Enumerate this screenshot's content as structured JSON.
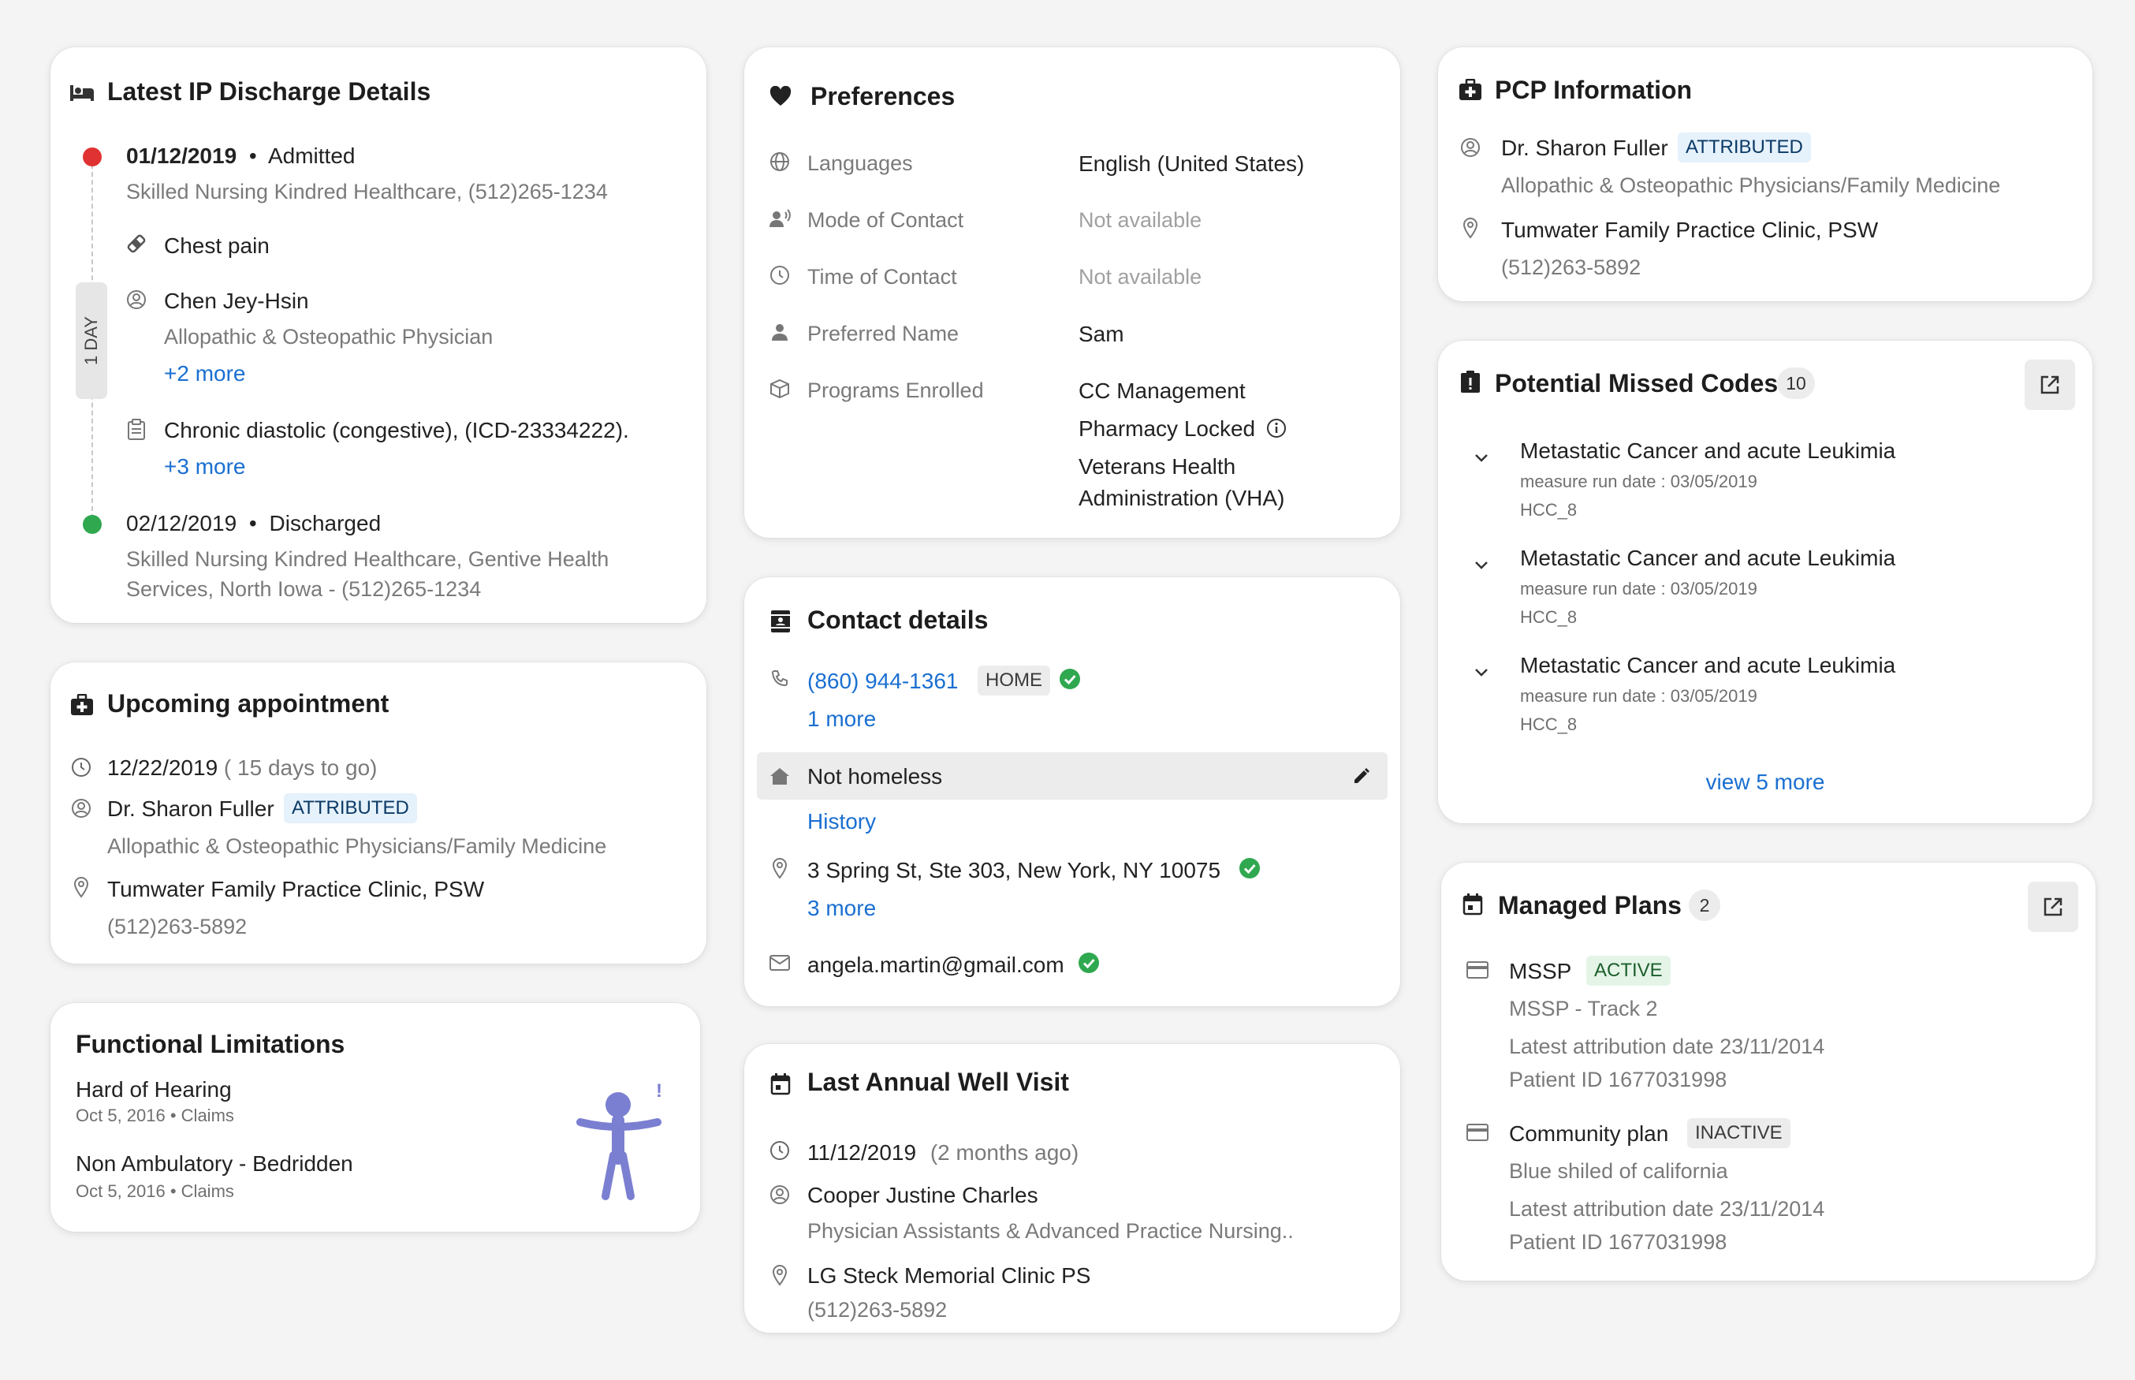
{
  "colors": {
    "background": "#f4f4f4",
    "link": "#1a6fd1",
    "admitted_dot": "#e03232",
    "discharged_dot": "#2fa84f",
    "verified": "#2fa84f",
    "figure": "#7b7fd1"
  },
  "discharge": {
    "title": "Latest IP Discharge Details",
    "admitted": {
      "date": "01/12/2019",
      "separator": "•",
      "status": "Admitted",
      "facility": "Skilled Nursing Kindred Healthcare, (512)265-1234"
    },
    "duration_label": "1 DAY",
    "complaint": "Chest pain",
    "provider": {
      "name": "Chen Jey-Hsin",
      "specialty": "Allopathic & Osteopathic Physician",
      "more": "+2 more"
    },
    "diagnosis": {
      "text": "Chronic diastolic (congestive), (ICD-23334222).",
      "more": "+3 more"
    },
    "discharged": {
      "date": "02/12/2019",
      "separator": "•",
      "status": "Discharged",
      "facility_line1": "Skilled Nursing Kindred Healthcare, Gentive Health",
      "facility_line2": "Services, North Iowa - (512)265-1234"
    }
  },
  "appointment": {
    "title": "Upcoming appointment",
    "date": "12/22/2019",
    "relative": "( 15 days  to go)",
    "doctor": "Dr. Sharon Fuller",
    "badge": "ATTRIBUTED",
    "specialty": "Allopathic & Osteopathic Physicians/Family Medicine",
    "clinic": "Tumwater Family Practice Clinic, PSW",
    "phone": "(512)263-5892"
  },
  "functional": {
    "title": "Functional Limitations",
    "items": [
      {
        "name": "Hard of Hearing",
        "meta": "Oct 5, 2016 • Claims"
      },
      {
        "name": "Non Ambulatory - Bedridden",
        "meta": "Oct 5, 2016 • Claims"
      }
    ],
    "figure_icon": "accessibility-figure-icon",
    "alert_mark": "!"
  },
  "preferences": {
    "title": "Preferences",
    "rows": [
      {
        "label": "Languages",
        "value": "English (United States)",
        "icon": "globe-icon"
      },
      {
        "label": "Mode of Contact",
        "value": "Not available",
        "icon": "voice-icon"
      },
      {
        "label": "Time of Contact",
        "value": "Not available",
        "icon": "clock-icon"
      },
      {
        "label": "Preferred Name",
        "value": "Sam",
        "icon": "person-icon"
      },
      {
        "label": "Programs Enrolled",
        "icon": "box-icon",
        "values": [
          "CC Management",
          "Pharmacy Locked",
          "Veterans Health",
          "Administration (VHA)"
        ]
      }
    ]
  },
  "contact": {
    "title": "Contact details",
    "phone": "(860) 944-1361",
    "phone_tag": "HOME",
    "phone_more": "1 more",
    "housing": "Not homeless",
    "history": "History",
    "address": "3 Spring St, Ste 303, New York, NY 10075",
    "address_more": "3 more",
    "email": "angela.martin@gmail.com"
  },
  "annual_visit": {
    "title": "Last Annual Well Visit",
    "date": "11/12/2019",
    "relative": "(2 months ago)",
    "provider": "Cooper Justine Charles",
    "specialty": "Physician Assistants & Advanced Practice Nursing..",
    "clinic": "LG Steck Memorial Clinic PS",
    "phone": "(512)263-5892"
  },
  "pcp": {
    "title": "PCP Information",
    "doctor": "Dr. Sharon Fuller",
    "badge": "ATTRIBUTED",
    "specialty": "Allopathic & Osteopathic Physicians/Family Medicine",
    "clinic": "Tumwater Family Practice Clinic, PSW",
    "phone": "(512)263-5892"
  },
  "missed_codes": {
    "title": "Potential Missed Codes",
    "count": "10",
    "items": [
      {
        "name": "Metastatic Cancer and acute Leukimia",
        "date": "measure run date : 03/05/2019",
        "code": "HCC_8"
      },
      {
        "name": "Metastatic Cancer and acute Leukimia",
        "date": "measure run date : 03/05/2019",
        "code": "HCC_8"
      },
      {
        "name": "Metastatic Cancer and acute Leukimia",
        "date": "measure run date : 03/05/2019",
        "code": "HCC_8"
      }
    ],
    "view_more": "view 5 more"
  },
  "plans": {
    "title": "Managed Plans",
    "count": "2",
    "items": [
      {
        "name": "MSSP",
        "status": "ACTIVE",
        "sub": "MSSP - Track 2",
        "attribution": "Latest attribution date 23/11/2014",
        "patient_id": "Patient ID 1677031998"
      },
      {
        "name": "Community plan",
        "status": "INACTIVE",
        "sub": "Blue shiled of california",
        "attribution": "Latest attribution date 23/11/2014",
        "patient_id": "Patient ID 1677031998"
      }
    ]
  }
}
